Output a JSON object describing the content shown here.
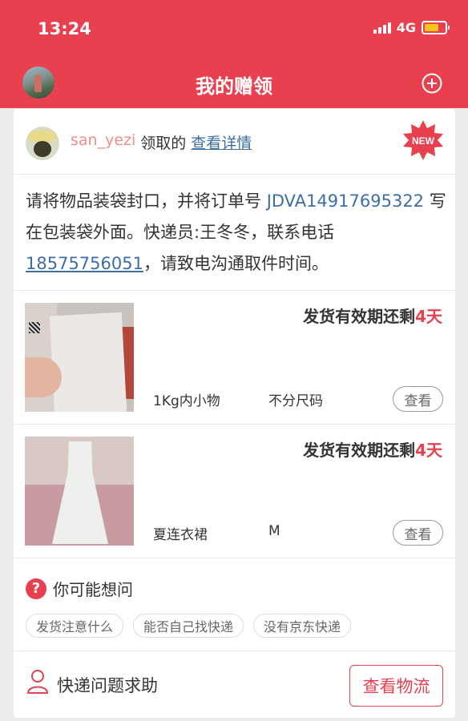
{
  "status_bar": {
    "time": "13:24",
    "network": "4G",
    "battery_icon": "battery-icon",
    "signal_icon": "signal-icon"
  },
  "header": {
    "title": "我的赠领",
    "add_icon": "plus-circle-icon"
  },
  "claim": {
    "username": "san_yezi",
    "claimed_text": "领取的",
    "detail_link": "查看详情",
    "badge": "NEW"
  },
  "instructions": {
    "part1": "请将物品装袋封口，并将订单号 ",
    "order_number": "JDVA14917695322",
    "part2": " 写在包装袋外面。快递员:王冬冬，联系电话 ",
    "phone": "18575756051",
    "part3": "，请致电沟通取件时间。"
  },
  "items": [
    {
      "validity_prefix": "发货有效期还剩",
      "validity_days": "4天",
      "name": "1Kg内小物",
      "size": "不分尺码",
      "view_label": "查看"
    },
    {
      "validity_prefix": "发货有效期还剩",
      "validity_days": "4天",
      "name": "夏连衣裙",
      "size": "M",
      "view_label": "查看"
    }
  ],
  "faq": {
    "title": "你可能想问",
    "tags": [
      "发货注意什么",
      "能否自己找快递",
      "没有京东快递"
    ]
  },
  "help": {
    "label": "快递问题求助",
    "button": "查看物流"
  },
  "colors": {
    "brand": "#e8404e",
    "link": "#3d6ea3",
    "username": "#ef8d87"
  }
}
